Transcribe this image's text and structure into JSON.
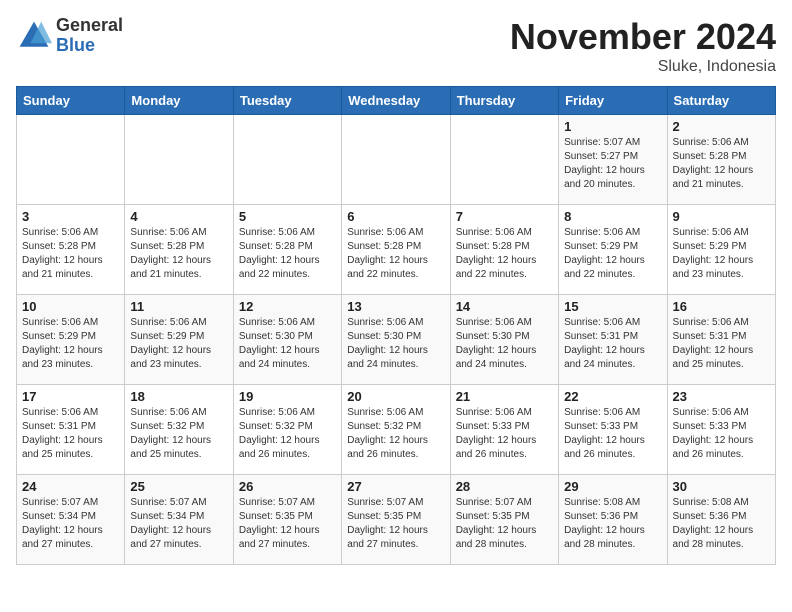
{
  "header": {
    "logo_general": "General",
    "logo_blue": "Blue",
    "month_year": "November 2024",
    "location": "Sluke, Indonesia"
  },
  "days_of_week": [
    "Sunday",
    "Monday",
    "Tuesday",
    "Wednesday",
    "Thursday",
    "Friday",
    "Saturday"
  ],
  "weeks": [
    {
      "days": [
        {
          "num": "",
          "info": ""
        },
        {
          "num": "",
          "info": ""
        },
        {
          "num": "",
          "info": ""
        },
        {
          "num": "",
          "info": ""
        },
        {
          "num": "",
          "info": ""
        },
        {
          "num": "1",
          "info": "Sunrise: 5:07 AM\nSunset: 5:27 PM\nDaylight: 12 hours\nand 20 minutes."
        },
        {
          "num": "2",
          "info": "Sunrise: 5:06 AM\nSunset: 5:28 PM\nDaylight: 12 hours\nand 21 minutes."
        }
      ]
    },
    {
      "days": [
        {
          "num": "3",
          "info": "Sunrise: 5:06 AM\nSunset: 5:28 PM\nDaylight: 12 hours\nand 21 minutes."
        },
        {
          "num": "4",
          "info": "Sunrise: 5:06 AM\nSunset: 5:28 PM\nDaylight: 12 hours\nand 21 minutes."
        },
        {
          "num": "5",
          "info": "Sunrise: 5:06 AM\nSunset: 5:28 PM\nDaylight: 12 hours\nand 22 minutes."
        },
        {
          "num": "6",
          "info": "Sunrise: 5:06 AM\nSunset: 5:28 PM\nDaylight: 12 hours\nand 22 minutes."
        },
        {
          "num": "7",
          "info": "Sunrise: 5:06 AM\nSunset: 5:28 PM\nDaylight: 12 hours\nand 22 minutes."
        },
        {
          "num": "8",
          "info": "Sunrise: 5:06 AM\nSunset: 5:29 PM\nDaylight: 12 hours\nand 22 minutes."
        },
        {
          "num": "9",
          "info": "Sunrise: 5:06 AM\nSunset: 5:29 PM\nDaylight: 12 hours\nand 23 minutes."
        }
      ]
    },
    {
      "days": [
        {
          "num": "10",
          "info": "Sunrise: 5:06 AM\nSunset: 5:29 PM\nDaylight: 12 hours\nand 23 minutes."
        },
        {
          "num": "11",
          "info": "Sunrise: 5:06 AM\nSunset: 5:29 PM\nDaylight: 12 hours\nand 23 minutes."
        },
        {
          "num": "12",
          "info": "Sunrise: 5:06 AM\nSunset: 5:30 PM\nDaylight: 12 hours\nand 24 minutes."
        },
        {
          "num": "13",
          "info": "Sunrise: 5:06 AM\nSunset: 5:30 PM\nDaylight: 12 hours\nand 24 minutes."
        },
        {
          "num": "14",
          "info": "Sunrise: 5:06 AM\nSunset: 5:30 PM\nDaylight: 12 hours\nand 24 minutes."
        },
        {
          "num": "15",
          "info": "Sunrise: 5:06 AM\nSunset: 5:31 PM\nDaylight: 12 hours\nand 24 minutes."
        },
        {
          "num": "16",
          "info": "Sunrise: 5:06 AM\nSunset: 5:31 PM\nDaylight: 12 hours\nand 25 minutes."
        }
      ]
    },
    {
      "days": [
        {
          "num": "17",
          "info": "Sunrise: 5:06 AM\nSunset: 5:31 PM\nDaylight: 12 hours\nand 25 minutes."
        },
        {
          "num": "18",
          "info": "Sunrise: 5:06 AM\nSunset: 5:32 PM\nDaylight: 12 hours\nand 25 minutes."
        },
        {
          "num": "19",
          "info": "Sunrise: 5:06 AM\nSunset: 5:32 PM\nDaylight: 12 hours\nand 26 minutes."
        },
        {
          "num": "20",
          "info": "Sunrise: 5:06 AM\nSunset: 5:32 PM\nDaylight: 12 hours\nand 26 minutes."
        },
        {
          "num": "21",
          "info": "Sunrise: 5:06 AM\nSunset: 5:33 PM\nDaylight: 12 hours\nand 26 minutes."
        },
        {
          "num": "22",
          "info": "Sunrise: 5:06 AM\nSunset: 5:33 PM\nDaylight: 12 hours\nand 26 minutes."
        },
        {
          "num": "23",
          "info": "Sunrise: 5:06 AM\nSunset: 5:33 PM\nDaylight: 12 hours\nand 26 minutes."
        }
      ]
    },
    {
      "days": [
        {
          "num": "24",
          "info": "Sunrise: 5:07 AM\nSunset: 5:34 PM\nDaylight: 12 hours\nand 27 minutes."
        },
        {
          "num": "25",
          "info": "Sunrise: 5:07 AM\nSunset: 5:34 PM\nDaylight: 12 hours\nand 27 minutes."
        },
        {
          "num": "26",
          "info": "Sunrise: 5:07 AM\nSunset: 5:35 PM\nDaylight: 12 hours\nand 27 minutes."
        },
        {
          "num": "27",
          "info": "Sunrise: 5:07 AM\nSunset: 5:35 PM\nDaylight: 12 hours\nand 27 minutes."
        },
        {
          "num": "28",
          "info": "Sunrise: 5:07 AM\nSunset: 5:35 PM\nDaylight: 12 hours\nand 28 minutes."
        },
        {
          "num": "29",
          "info": "Sunrise: 5:08 AM\nSunset: 5:36 PM\nDaylight: 12 hours\nand 28 minutes."
        },
        {
          "num": "30",
          "info": "Sunrise: 5:08 AM\nSunset: 5:36 PM\nDaylight: 12 hours\nand 28 minutes."
        }
      ]
    }
  ]
}
